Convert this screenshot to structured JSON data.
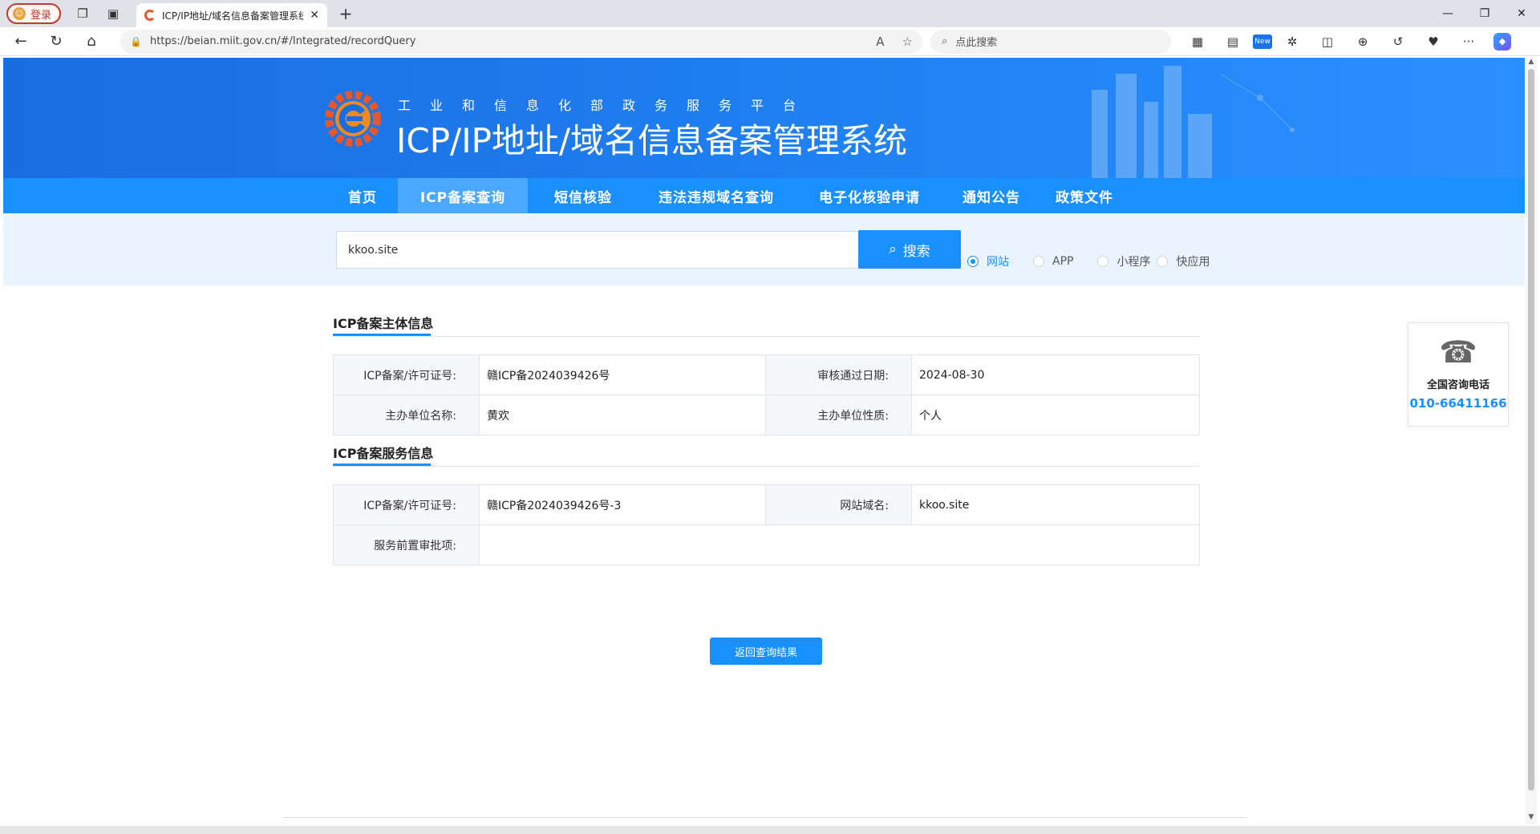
{
  "browser": {
    "profile_label": "登录",
    "tab_title": "ICP/IP地址/域名信息备案管理系统",
    "url": "https://beian.miit.gov.cn/#/Integrated/recordQuery",
    "search_placeholder": "点此搜索",
    "new_badge": "New"
  },
  "header": {
    "subtitle": "工业和信息化部政务服务平台",
    "title": "ICP/IP地址/域名信息备案管理系统"
  },
  "nav": {
    "items": [
      "首页",
      "ICP备案查询",
      "短信核验",
      "违法违规域名查询",
      "电子化核验申请",
      "通知公告",
      "政策文件"
    ],
    "active_index": 1
  },
  "search": {
    "value": "kkoo.site",
    "button_label": "搜索",
    "options": [
      "网站",
      "APP",
      "小程序",
      "快应用"
    ],
    "selected": "网站"
  },
  "subject_section": {
    "title": "ICP备案主体信息",
    "rows": [
      {
        "k1": "ICP备案/许可证号:",
        "v1": "赣ICP备2024039426号",
        "k2": "审核通过日期:",
        "v2": "2024-08-30"
      },
      {
        "k1": "主办单位名称:",
        "v1": "黄欢",
        "k2": "主办单位性质:",
        "v2": "个人"
      }
    ]
  },
  "service_section": {
    "title": "ICP备案服务信息",
    "rows": [
      {
        "k1": "ICP备案/许可证号:",
        "v1": "赣ICP备2024039426号-3",
        "k2": "网站域名:",
        "v2": "kkoo.site"
      },
      {
        "k1": "服务前置审批项:",
        "v1": ""
      }
    ]
  },
  "back_button": "返回查询结果",
  "hotline": {
    "label": "全国咨询电话",
    "number": "010-66411166"
  },
  "colors": {
    "primary": "#1890ff",
    "banner": "#1f7ff0",
    "search_band": "#e9f4ff"
  }
}
